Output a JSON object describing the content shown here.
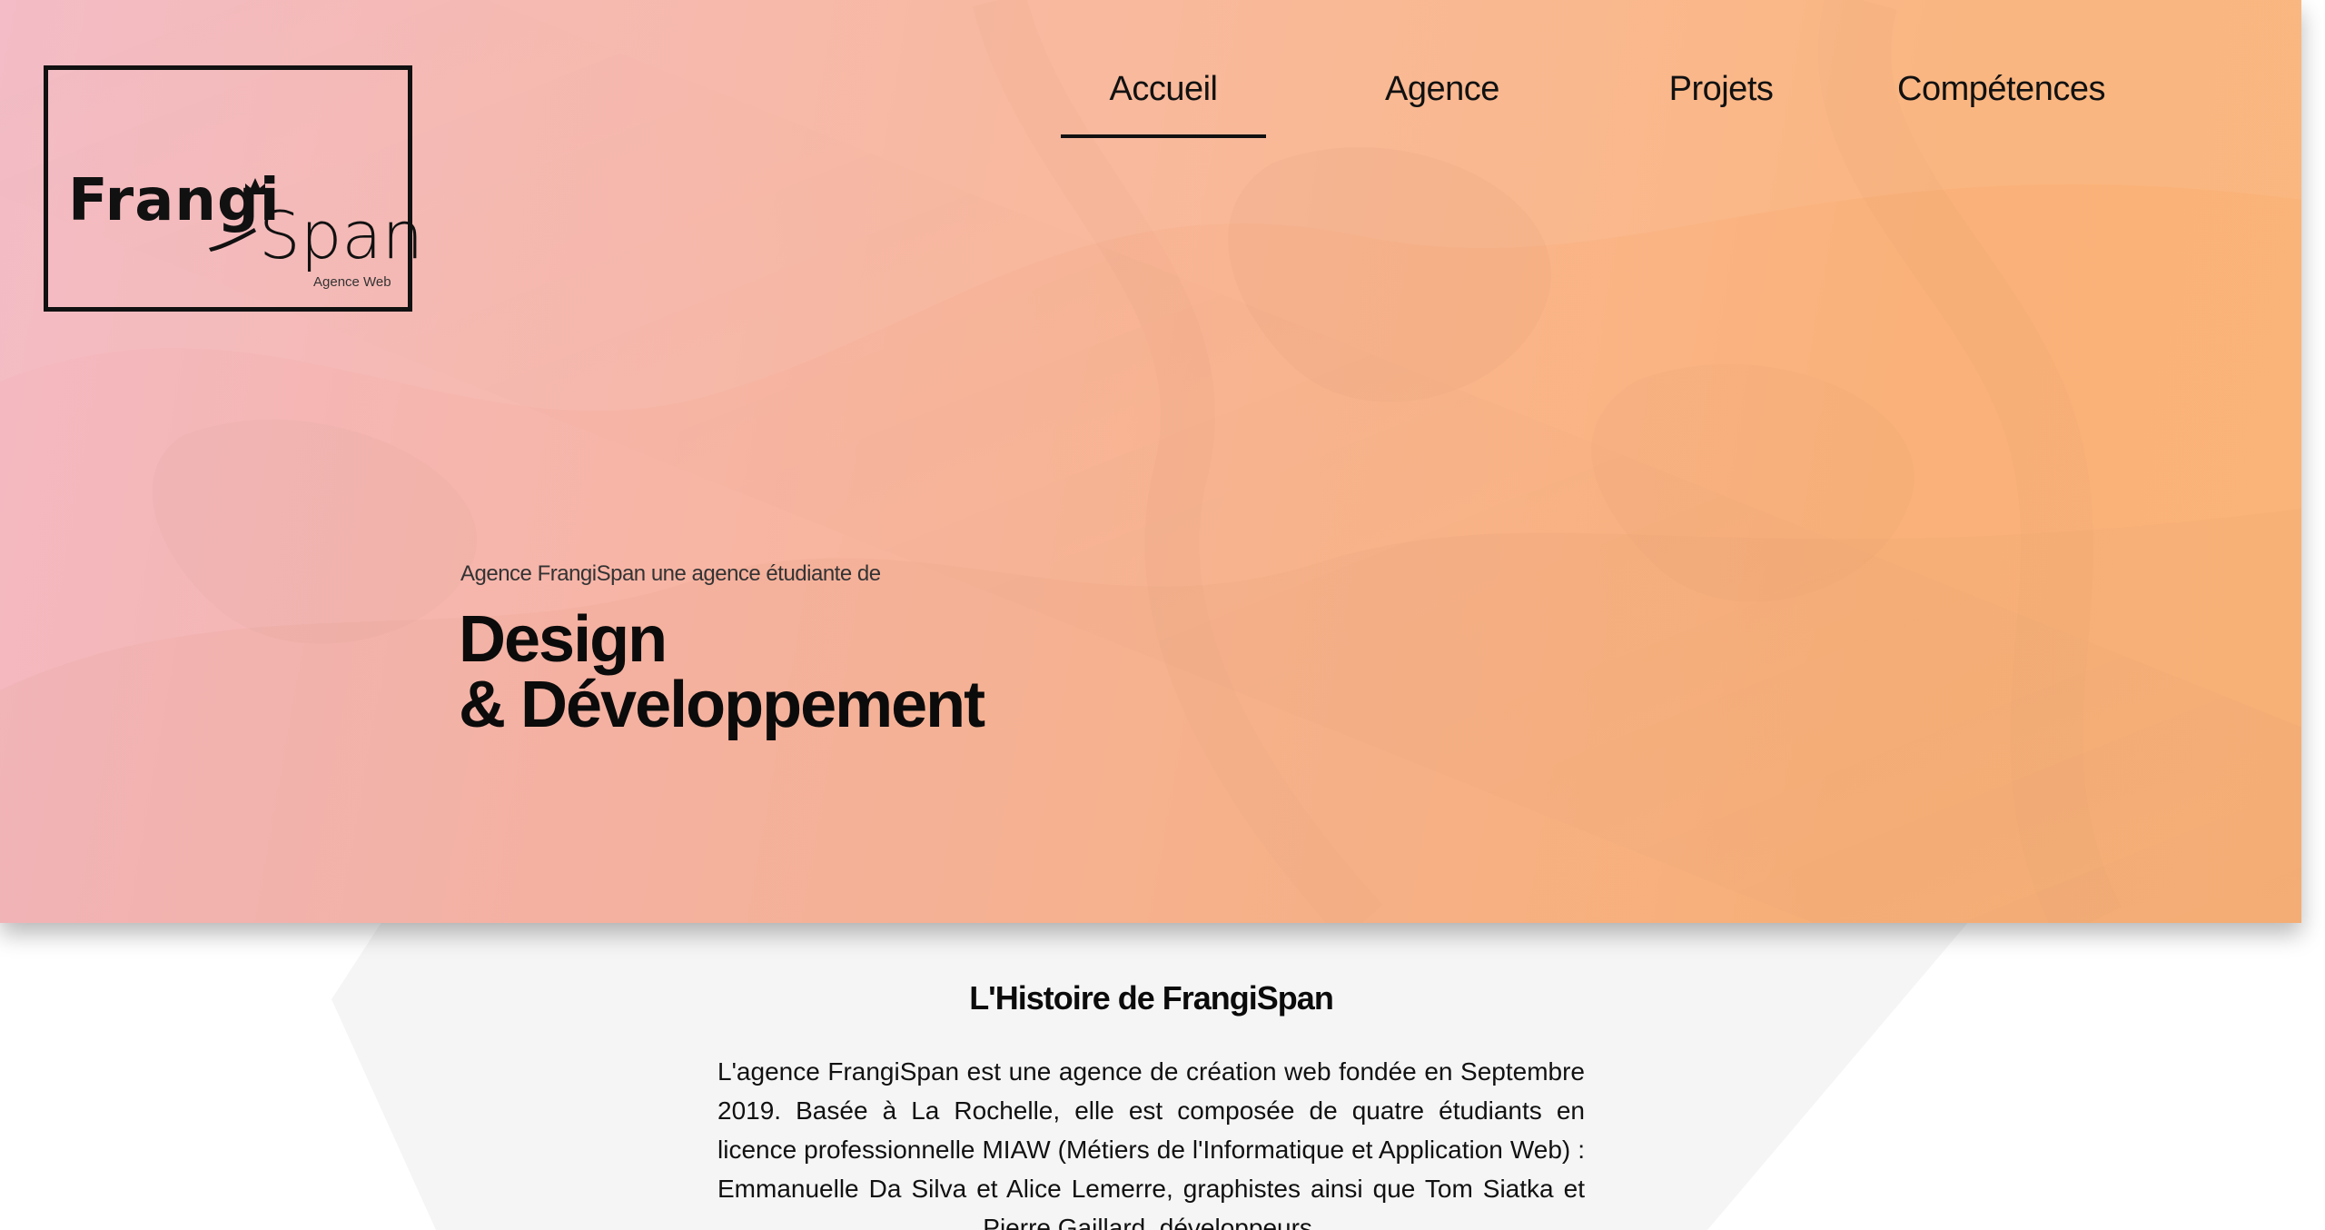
{
  "logo": {
    "name_bold": "Frangi",
    "name_light": "Span",
    "tagline": "Agence Web"
  },
  "nav": {
    "items": [
      {
        "label": "Accueil",
        "active": true
      },
      {
        "label": "Agence",
        "active": false
      },
      {
        "label": "Projets",
        "active": false
      },
      {
        "label": "Compétences",
        "active": false
      }
    ]
  },
  "hero": {
    "kicker": "Agence FrangiSpan une agence étudiante de",
    "title_line1": "Design",
    "title_line2": "& Développement"
  },
  "history": {
    "title": "L'Histoire de FrangiSpan",
    "text": "L'agence FrangiSpan est une agence de création web fondée en Septembre 2019. Basée à La Rochelle, elle est composée de quatre étudiants en licence professionnelle MIAW (Métiers de l'Informatique et Application Web) : Emmanuelle Da Silva et Alice Lemerre, graphistes ainsi que Tom Siatka et Pierre Gaillard, développeurs."
  },
  "colors": {
    "hero_pink": "#f3b8c3",
    "hero_orange": "#fab378",
    "section_shape": "#f5f5f5",
    "text": "#111111"
  }
}
